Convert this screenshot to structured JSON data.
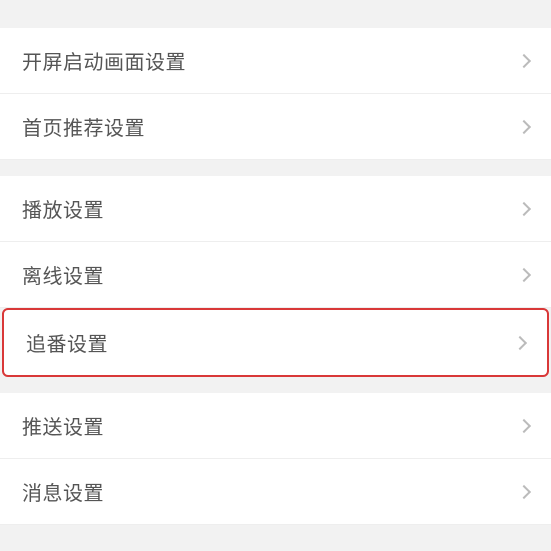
{
  "settings": {
    "group1": {
      "items": [
        {
          "label": "开屏启动画面设置"
        },
        {
          "label": "首页推荐设置"
        }
      ]
    },
    "group2": {
      "items": [
        {
          "label": "播放设置"
        },
        {
          "label": "离线设置"
        },
        {
          "label": "追番设置",
          "highlighted": true
        }
      ]
    },
    "group3": {
      "items": [
        {
          "label": "推送设置"
        },
        {
          "label": "消息设置"
        }
      ]
    }
  }
}
